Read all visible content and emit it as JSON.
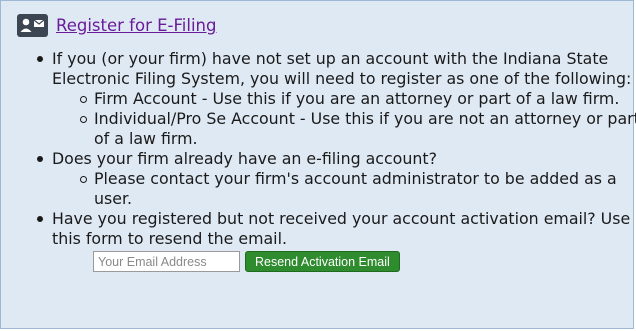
{
  "header": {
    "icon": "contact-card-icon",
    "link_text": "Register for E-Filing"
  },
  "items": [
    {
      "text": "If you (or your firm) have not set up an account with the Indiana State Electronic Filing System, you will need to register as one of the following:",
      "sub": [
        "Firm Account - Use this if you are an attorney or part of a law firm.",
        "Individual/Pro Se Account - Use this if you are not an attorney or part of a law firm."
      ]
    },
    {
      "text": "Does your firm already have an e-filing account?",
      "sub": [
        "Please contact your firm's account administrator to be added as a user."
      ]
    },
    {
      "text": "Have you registered but not received your account activation email? Use this form to resend the email."
    }
  ],
  "resend_form": {
    "email_placeholder": "Your Email Address",
    "email_value": "",
    "button_label": "Resend Activation Email"
  },
  "colors": {
    "panel_background": "#dfe9f4",
    "panel_border": "#9fb8d4",
    "link": "#6a1b9a",
    "button_green": "#2e8b2e"
  }
}
